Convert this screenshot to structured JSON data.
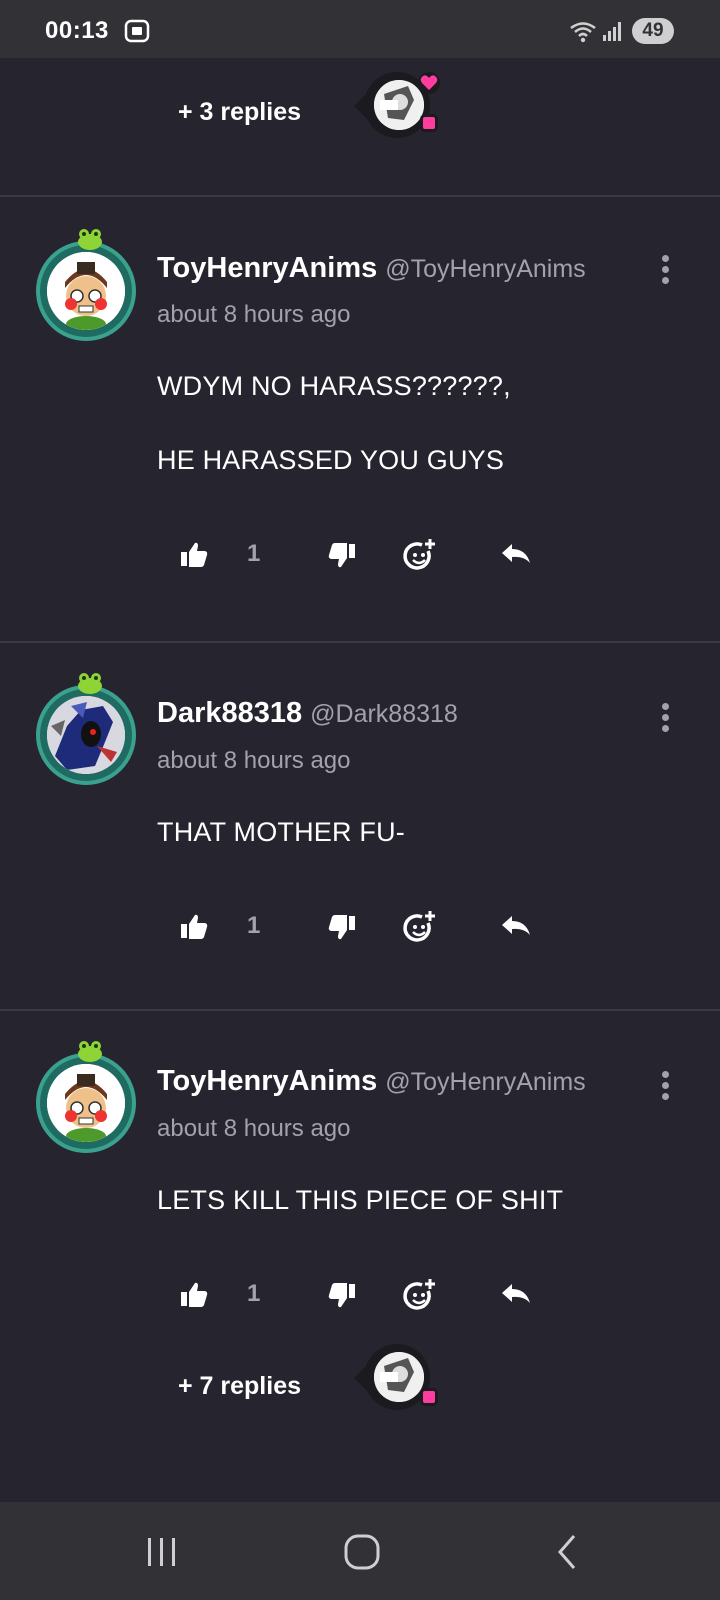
{
  "status_bar": {
    "time": "00:13",
    "battery": "49",
    "icons": [
      "screenshot-icon",
      "wifi-icon",
      "signal-icon",
      "battery-icon"
    ]
  },
  "top_replies": {
    "label": "+ 3 replies"
  },
  "comments": [
    {
      "username": "ToyHenryAnims",
      "handle": "@ToyHenryAnims",
      "time": "about 8 hours ago",
      "lines": [
        "WDYM NO HARASS??????,",
        "HE HARASSED YOU GUYS"
      ],
      "likes": "1"
    },
    {
      "username": "Dark88318",
      "handle": "@Dark88318",
      "time": "about 8 hours ago",
      "lines": [
        "THAT MOTHER FU-"
      ],
      "likes": "1"
    },
    {
      "username": "ToyHenryAnims",
      "handle": "@ToyHenryAnims",
      "time": "about 8 hours ago",
      "lines": [
        "LETS KILL THIS PIECE OF SHIT"
      ],
      "likes": "1"
    }
  ],
  "bottom_replies": {
    "label": "+ 7 replies"
  },
  "colors": {
    "background": "#26252f",
    "bars": "#323236",
    "muted_text": "#a3a2ab",
    "accent_pink": "#ff3d9e",
    "avatar_ring": "#3aa18f"
  },
  "nav_bar": {
    "icons": [
      "recent-apps-icon",
      "home-icon",
      "back-icon"
    ]
  }
}
